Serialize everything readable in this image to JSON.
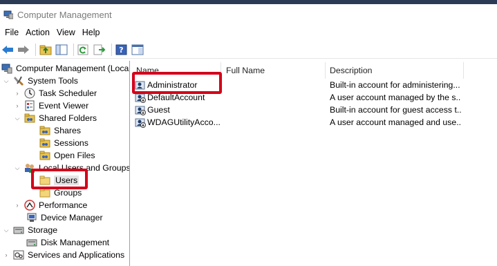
{
  "window": {
    "title": "Computer Management"
  },
  "menu": [
    "File",
    "Action",
    "View",
    "Help"
  ],
  "toolbar": {
    "buttons": [
      "back-arrow-icon",
      "forward-arrow-icon",
      "up-folder-icon",
      "show-hide-tree-icon",
      "refresh-icon",
      "export-list-icon",
      "help-icon",
      "properties-icon"
    ]
  },
  "tree": {
    "root": "Computer Management (Local",
    "system_tools": "System Tools",
    "task_scheduler": "Task Scheduler",
    "event_viewer": "Event Viewer",
    "shared_folders": "Shared Folders",
    "shares": "Shares",
    "sessions": "Sessions",
    "open_files": "Open Files",
    "local_users_groups": "Local Users and Groups",
    "users": "Users",
    "groups": "Groups",
    "performance": "Performance",
    "device_manager": "Device Manager",
    "storage": "Storage",
    "disk_management": "Disk Management",
    "services_apps": "Services and Applications"
  },
  "list": {
    "columns": {
      "name": "Name",
      "full_name": "Full Name",
      "description": "Description"
    },
    "rows": [
      {
        "name": "Administrator",
        "full_name": "",
        "description": "Built-in account for administering..."
      },
      {
        "name": "DefaultAccount",
        "full_name": "",
        "description": "A user account managed by the s..."
      },
      {
        "name": "Guest",
        "full_name": "",
        "description": "Built-in account for guest access t..."
      },
      {
        "name": "WDAGUtilityAcco...",
        "full_name": "",
        "description": "A user account managed and use..."
      }
    ]
  },
  "colors": {
    "highlight": "#d4001a",
    "selection": "#e5e5e5"
  }
}
